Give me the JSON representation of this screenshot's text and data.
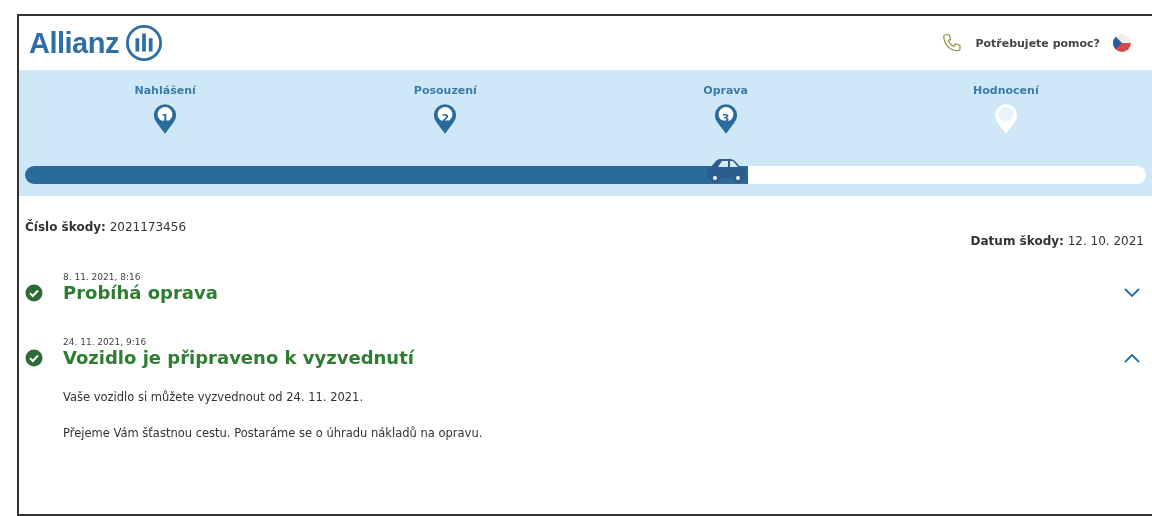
{
  "header": {
    "logo": "Allianz",
    "help": "Potřebujete pomoc?"
  },
  "progress": {
    "level": 0.645,
    "steps": [
      {
        "label": "Nahlášení",
        "number": "1",
        "reached": true
      },
      {
        "label": "Posouzení",
        "number": "2",
        "reached": true
      },
      {
        "label": "Oprava",
        "number": "3",
        "reached": true
      },
      {
        "label": "Hodnocení",
        "reached": false
      }
    ]
  },
  "claim": {
    "number_label": "Číslo škody:",
    "number": "2021173456",
    "date_label": "Datum škody:",
    "date": "12. 10. 2021"
  },
  "events": [
    {
      "date": "8. 11. 2021, 8:16",
      "title": "Probíhá oprava",
      "done": true,
      "expanded": false
    },
    {
      "date": "24. 11. 2021, 9:16",
      "title": "Vozidlo je připraveno k vyzvednutí",
      "done": true,
      "expanded": true,
      "paragraphs": [
        "Vaše vozidlo si můžete vyzvednout od 24. 11. 2021.",
        "Přejeme Vám šťastnou cestu. Postaráme se o úhradu nákladů na opravu."
      ]
    }
  ]
}
